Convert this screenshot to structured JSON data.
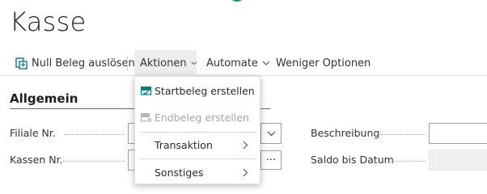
{
  "page": {
    "title": "Kasse"
  },
  "action_bar": {
    "null_beleg": "Null Beleg auslösen",
    "aktionen": "Aktionen",
    "automate": "Automate",
    "weniger": "Weniger Optionen"
  },
  "section": {
    "title": "Allgemein"
  },
  "fields": {
    "filiale_label": "Filiale Nr.",
    "kassen_label": "Kassen Nr.",
    "beschreibung_label": "Beschreibung",
    "saldo_label": "Saldo bis Datum"
  },
  "menu": {
    "startbeleg": "Startbeleg erstellen",
    "endbeleg": "Endbeleg erstellen",
    "transaktion": "Transaktion",
    "sonstiges": "Sonstiges"
  },
  "lookup": {
    "ellipsis": "···"
  },
  "colors": {
    "accent": "#008489",
    "icon_teal": "#0f7b7c"
  }
}
